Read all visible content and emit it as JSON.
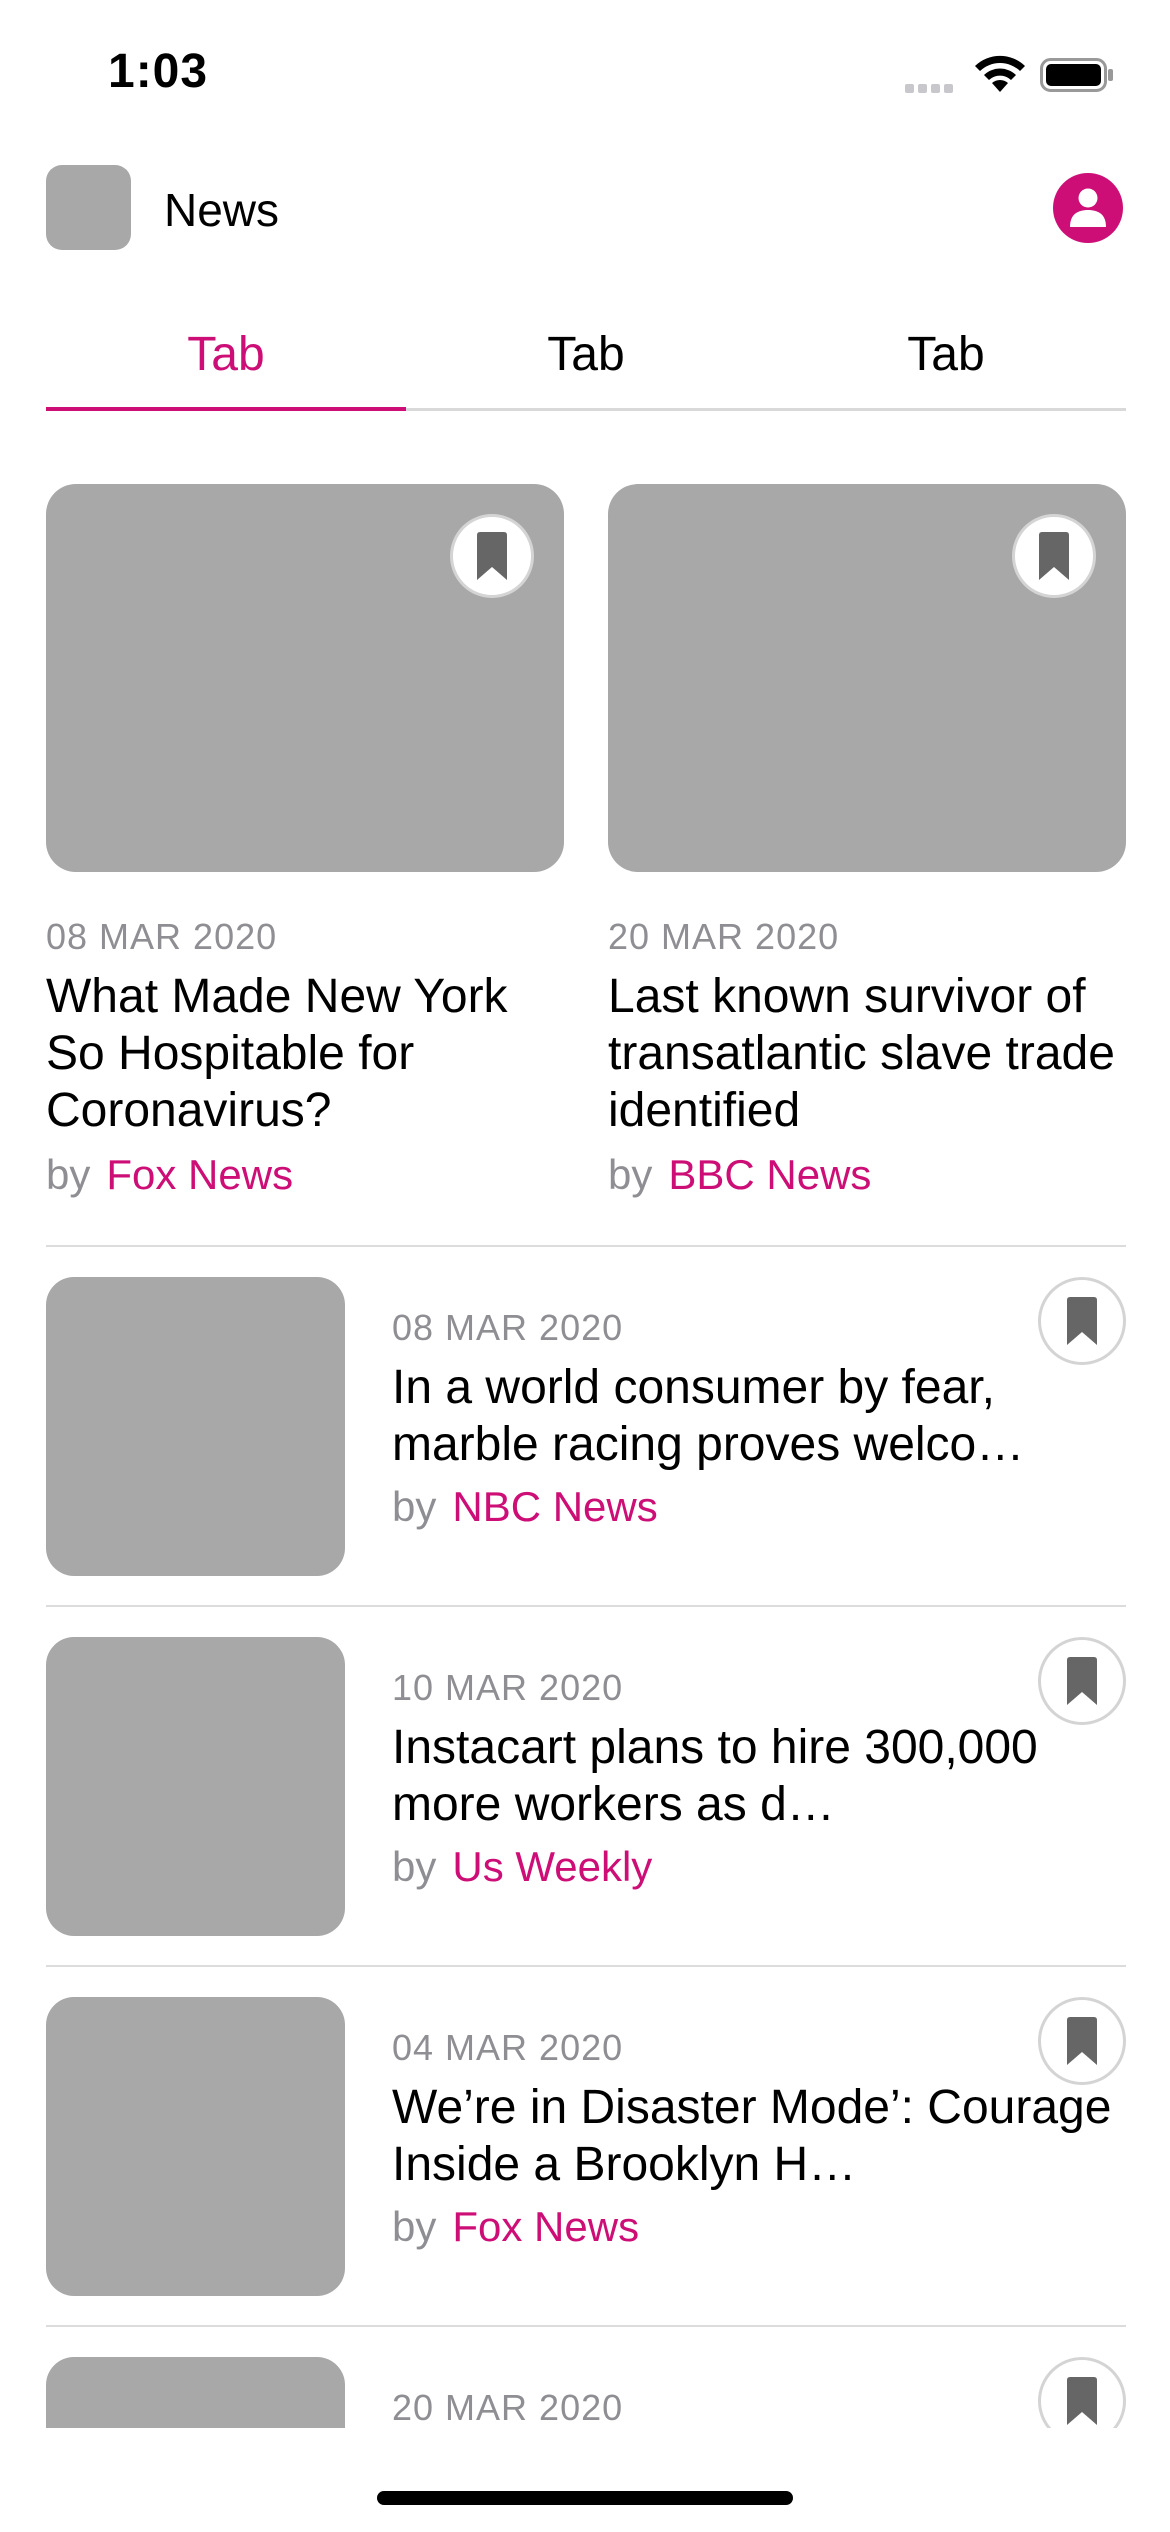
{
  "status_bar": {
    "time": "1:03"
  },
  "header": {
    "title": "News"
  },
  "tabs": [
    {
      "label": "Tab",
      "active": true
    },
    {
      "label": "Tab",
      "active": false
    },
    {
      "label": "Tab",
      "active": false
    }
  ],
  "featured": [
    {
      "date": "08 MAR 2020",
      "title": "What Made New York So Hospitable for Coronavirus?",
      "by": "by",
      "source": "Fox News"
    },
    {
      "date": "20 MAR 2020",
      "title": "Last known survivor of transatlantic slave trade identified",
      "by": "by",
      "source": "BBC News"
    }
  ],
  "articles": [
    {
      "date": "08 MAR 2020",
      "title": "In a world consumer by fear, marble racing proves welco…",
      "by": "by",
      "source": "NBC News"
    },
    {
      "date": "10 MAR 2020",
      "title": "Instacart plans to hire 300,000 more workers as d…",
      "by": "by",
      "source": "Us Weekly"
    },
    {
      "date": "04 MAR 2020",
      "title": "We’re in Disaster Mode’: Courage Inside a Brooklyn H…",
      "by": "by",
      "source": "Fox News"
    },
    {
      "date": "20 MAR 2020",
      "title": "",
      "by": "",
      "source": ""
    }
  ],
  "colors": {
    "accent": "#cc0e76",
    "placeholder": "#a8a8a8",
    "secondary_text": "#8e8e93"
  },
  "icons": {
    "profile": "person-icon",
    "bookmark": "bookmark-icon",
    "wifi": "wifi-icon",
    "battery": "battery-icon"
  }
}
